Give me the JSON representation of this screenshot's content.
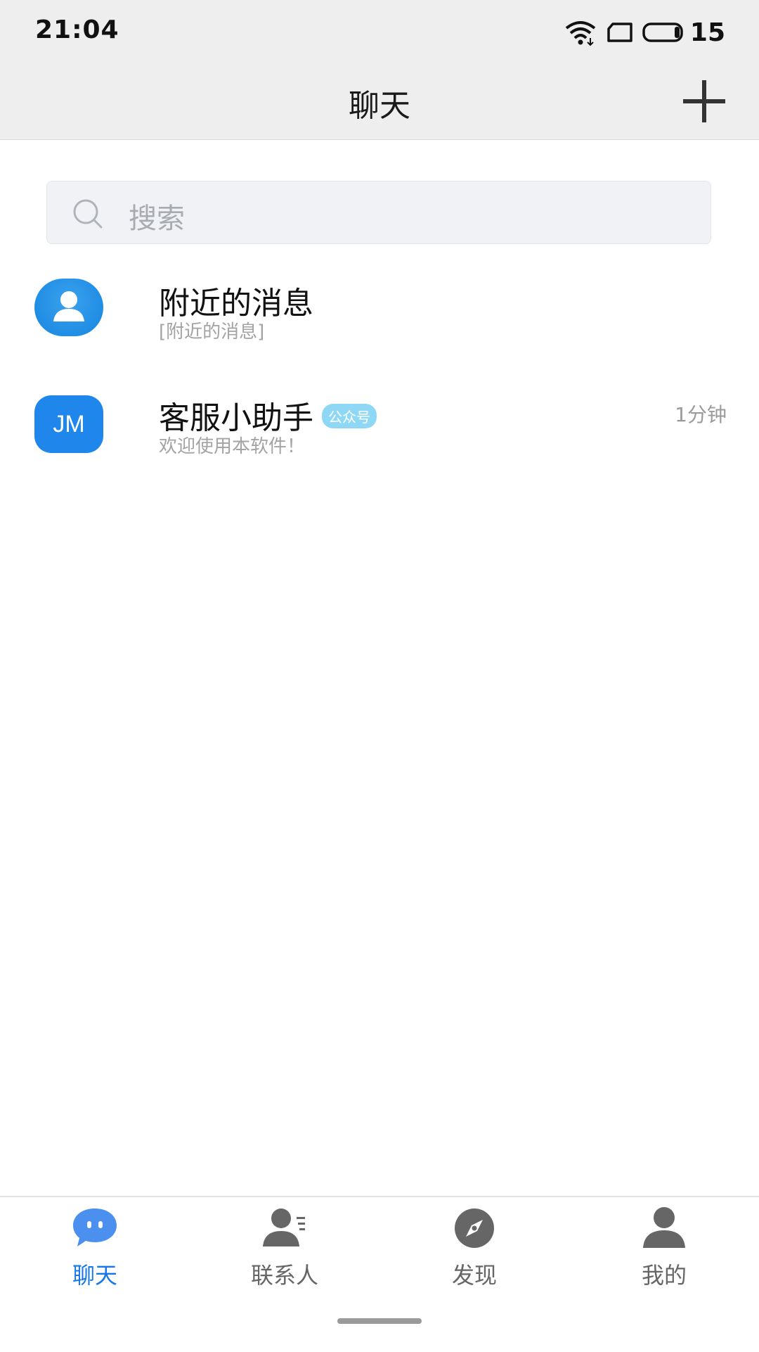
{
  "status_bar": {
    "time": "21:04",
    "battery_level": "15",
    "icons": [
      "wifi-icon",
      "sim-icon",
      "battery-icon"
    ]
  },
  "header": {
    "title": "聊天",
    "add_icon": "plus-icon"
  },
  "search": {
    "placeholder": "搜索",
    "icon": "search-icon"
  },
  "conversations": [
    {
      "name": "附近的消息",
      "preview": "[附近的消息]",
      "avatar_icon": "person-icon",
      "time": ""
    },
    {
      "name": "客服小助手",
      "badge": "公众号",
      "preview": "欢迎使用本软件！",
      "avatar_text": "JM",
      "time": "1分钟"
    }
  ],
  "bottom_nav": {
    "tabs": [
      {
        "label": "聊天",
        "icon": "chat-bubble-icon",
        "active": true
      },
      {
        "label": "联系人",
        "icon": "contacts-icon",
        "active": false
      },
      {
        "label": "发现",
        "icon": "compass-icon",
        "active": false
      },
      {
        "label": "我的",
        "icon": "profile-icon",
        "active": false
      }
    ]
  },
  "colors": {
    "accent": "#1677e6",
    "header_bg": "#eeeeee",
    "badge": "#8fd8f5"
  }
}
